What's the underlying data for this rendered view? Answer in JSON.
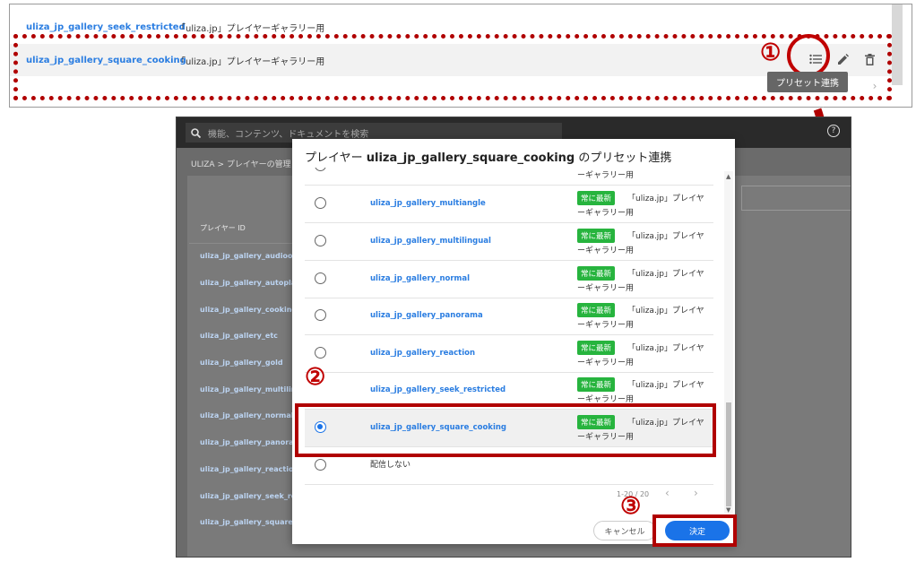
{
  "top_panel": {
    "rows": [
      {
        "id": "uliza_jp_gallery_seek_restricted",
        "description": "「uliza.jp」プレイヤーギャラリー用"
      },
      {
        "id": "uliza_jp_gallery_square_cooking",
        "description": "「uliza.jp」プレイヤーギャラリー用"
      }
    ],
    "tooltip": "プリセット連携",
    "step_label": "①"
  },
  "background_app": {
    "search_placeholder": "機能、コンテンツ、ドキュメントを検索",
    "breadcrumb": "ULIZA  >  プレイヤーの管理",
    "column_header": "プレイヤー ID",
    "items": [
      "uliza_jp_gallery_audioonly",
      "uliza_jp_gallery_autoplay",
      "uliza_jp_gallery_cooking",
      "uliza_jp_gallery_etc",
      "uliza_jp_gallery_gold",
      "uliza_jp_gallery_multilingual",
      "uliza_jp_gallery_normal",
      "uliza_jp_gallery_panorama",
      "uliza_jp_gallery_reaction",
      "uliza_jp_gallery_seek_restricted",
      "uliza_jp_gallery_square_cooking"
    ]
  },
  "modal": {
    "title_prefix": "プレイヤー ",
    "title_id": "uliza_jp_gallery_square_cooking",
    "title_suffix": " のプリセット連携",
    "partial_row_text": "ーギャラリー用",
    "rows": [
      {
        "id": "uliza_jp_gallery_multiangle",
        "badge": "常に最新",
        "desc1": "「uliza.jp」プレイヤ",
        "desc2": "ーギャラリー用",
        "selected": false
      },
      {
        "id": "uliza_jp_gallery_multilingual",
        "badge": "常に最新",
        "desc1": "「uliza.jp」プレイヤ",
        "desc2": "ーギャラリー用",
        "selected": false
      },
      {
        "id": "uliza_jp_gallery_normal",
        "badge": "常に最新",
        "desc1": "「uliza.jp」プレイヤ",
        "desc2": "ーギャラリー用",
        "selected": false
      },
      {
        "id": "uliza_jp_gallery_panorama",
        "badge": "常に最新",
        "desc1": "「uliza.jp」プレイヤ",
        "desc2": "ーギャラリー用",
        "selected": false
      },
      {
        "id": "uliza_jp_gallery_reaction",
        "badge": "常に最新",
        "desc1": "「uliza.jp」プレイヤ",
        "desc2": "ーギャラリー用",
        "selected": false
      },
      {
        "id": "uliza_jp_gallery_seek_restricted",
        "badge": "常に最新",
        "desc1": "「uliza.jp」プレイヤ",
        "desc2": "ーギャラリー用",
        "selected": false
      },
      {
        "id": "uliza_jp_gallery_square_cooking",
        "badge": "常に最新",
        "desc1": "「uliza.jp」プレイヤ",
        "desc2": "ーギャラリー用",
        "selected": true
      }
    ],
    "no_delivery_label": "配信しない",
    "pager_text": "1-20 / 20",
    "cancel_label": "キャンセル",
    "ok_label": "決定"
  },
  "step_labels": {
    "two": "②",
    "three": "③"
  },
  "colors": {
    "accent": "#1a73e8",
    "annotation_red": "#c00000",
    "badge_green": "#27b43e",
    "link_blue": "#2a7de1"
  }
}
